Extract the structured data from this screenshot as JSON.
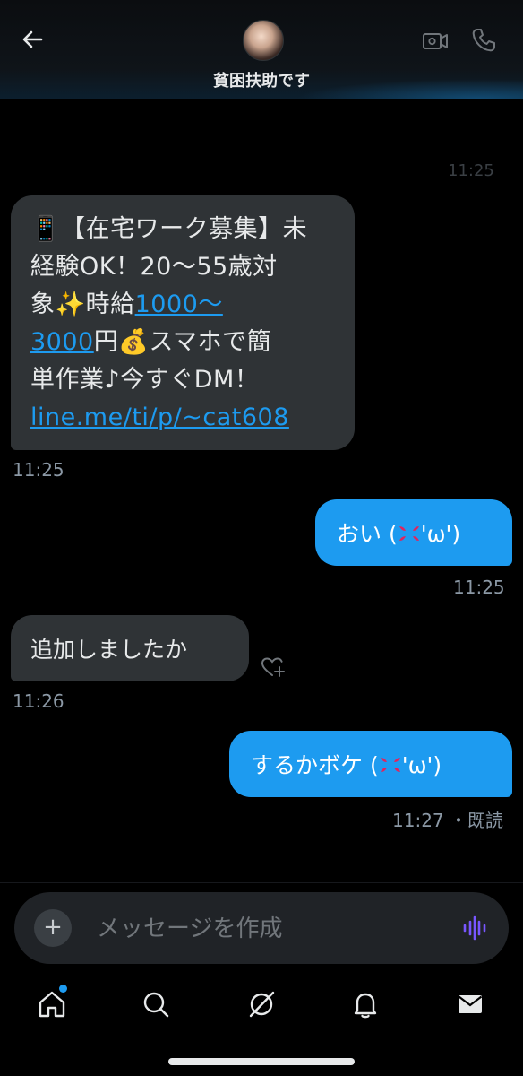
{
  "header": {
    "back_icon": "arrow-left-icon",
    "title": "貧困扶助です",
    "video_icon": "video-call-icon",
    "phone_icon": "phone-icon"
  },
  "faded_timestamp": "11:25",
  "messages": [
    {
      "direction": "incoming",
      "lines": [
        "📱【在宅ワーク募集】未",
        "経験OK！20～55歳対",
        "象✨時給",
        "1000～",
        "3000",
        "円💰スマホで簡",
        "単作業♪今すぐDM！",
        "line.me/ti/p/~cat608"
      ],
      "time": "11:25"
    },
    {
      "direction": "outgoing",
      "text_before": "おい (",
      "text_after": "'ω')",
      "time": "11:25"
    },
    {
      "direction": "incoming",
      "text": "追加しましたか",
      "time": "11:26"
    },
    {
      "direction": "outgoing",
      "text_before": "するかボケ (",
      "text_after": "'ω')",
      "time": "11:27",
      "status": "・既読"
    }
  ],
  "composer": {
    "placeholder": "メッセージを作成",
    "add_icon": "+",
    "voice_icon": "voice-wave-icon"
  },
  "nav": {
    "items": [
      "home-icon",
      "search-icon",
      "grok-icon",
      "notifications-bell-icon",
      "messages-envelope-icon"
    ],
    "active": "home-icon"
  },
  "colors": {
    "accent": "#1d9bf0",
    "incoming_bubble": "#2f3336",
    "timestamp": "#8b98a5",
    "background": "#000000"
  }
}
